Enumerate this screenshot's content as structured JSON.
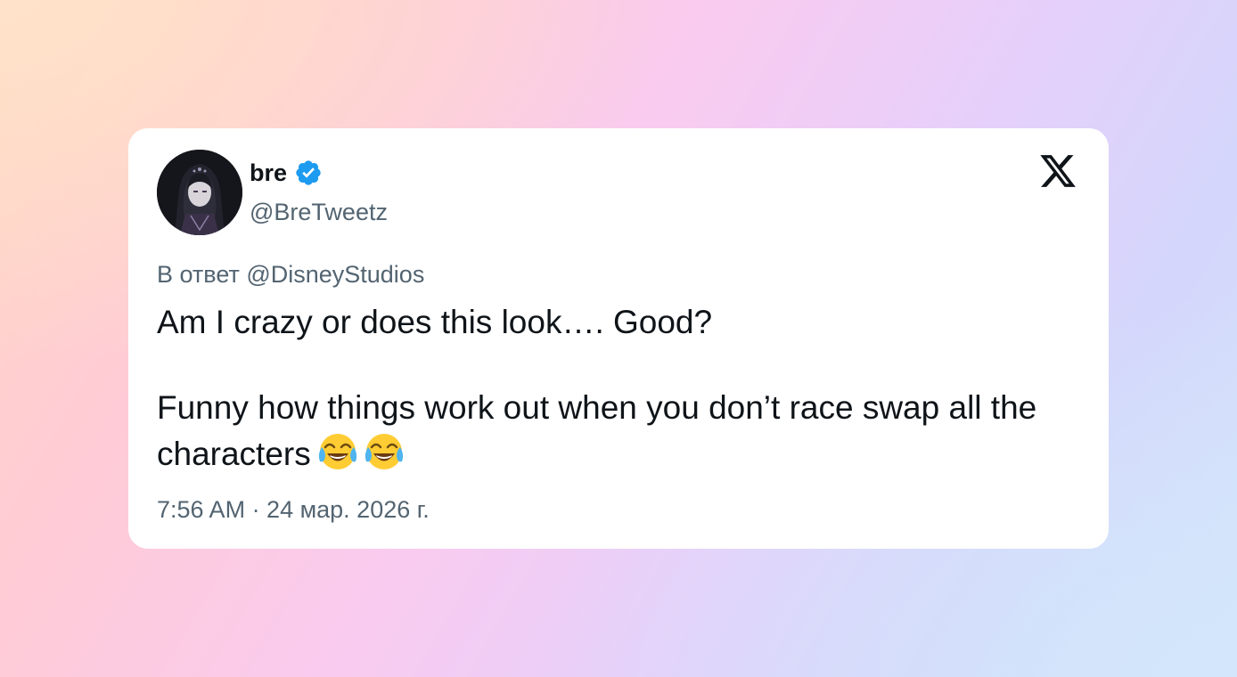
{
  "tweet": {
    "display_name": "bre",
    "handle": "@BreTweetz",
    "verified": true,
    "reply_to": "В ответ @DisneyStudios",
    "text_line1": "Am I crazy or does this look…. Good?",
    "text_line2": "Funny how things work out when you don’t race swap all the characters",
    "emojis": [
      "face-with-tears-of-joy-icon",
      "face-with-tears-of-joy-icon"
    ],
    "timestamp": "7:56 AM · 24 мар. 2026 г."
  },
  "icons": {
    "verified": "verified-badge-icon",
    "platform": "x-logo-icon",
    "avatar": "profile-avatar"
  },
  "colors": {
    "verified_blue": "#1d9bf0",
    "text_primary": "#0f1419",
    "text_secondary": "#536471",
    "card_bg": "#ffffff"
  }
}
